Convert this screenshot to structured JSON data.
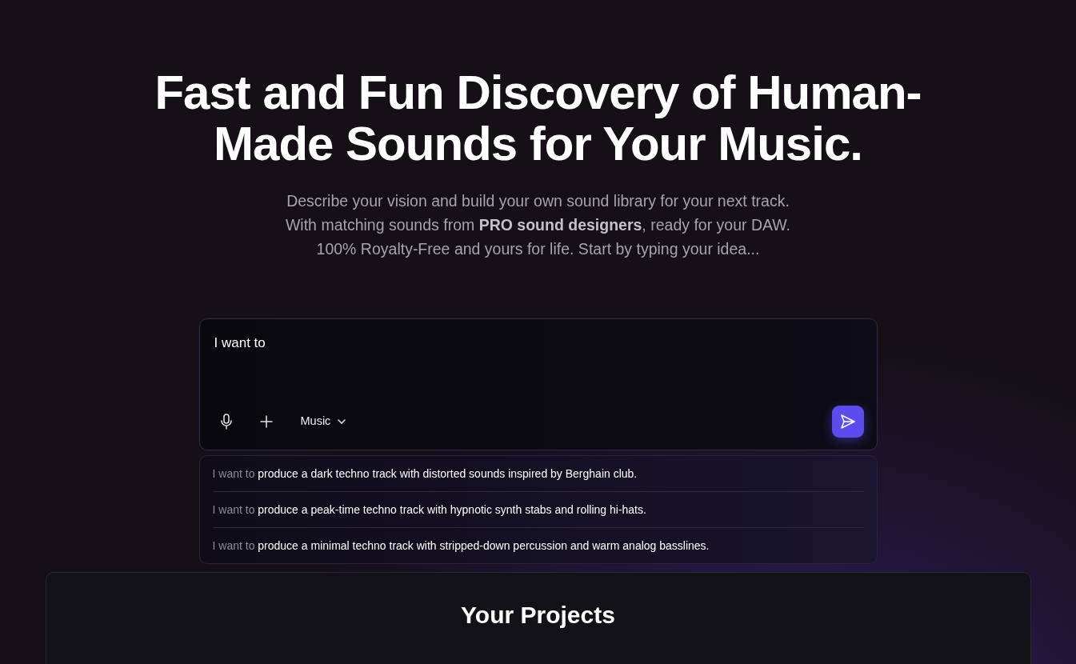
{
  "hero": {
    "title": "Fast and Fun Discovery of Human-Made Sounds for Your Music.",
    "subtitle_lines": [
      "Describe your vision and build your own sound library for your next track.",
      "With matching sounds from **PRO sound designers**, ready for your DAW.",
      "100% Royalty-Free and yours for life. Start by typing your idea..."
    ]
  },
  "prompt": {
    "value": "I want to",
    "mode": "Music"
  },
  "suggestions": [
    {
      "prefix": "I want to",
      "text": "produce a dark techno track with distorted sounds inspired by Berghain club."
    },
    {
      "prefix": "I want to",
      "text": "produce a peak-time techno track with hypnotic synth stabs and rolling hi-hats."
    },
    {
      "prefix": "I want to",
      "text": "produce a minimal techno track with stripped-down percussion and warm analog basslines."
    }
  ],
  "projects": {
    "title": "Your Projects"
  }
}
